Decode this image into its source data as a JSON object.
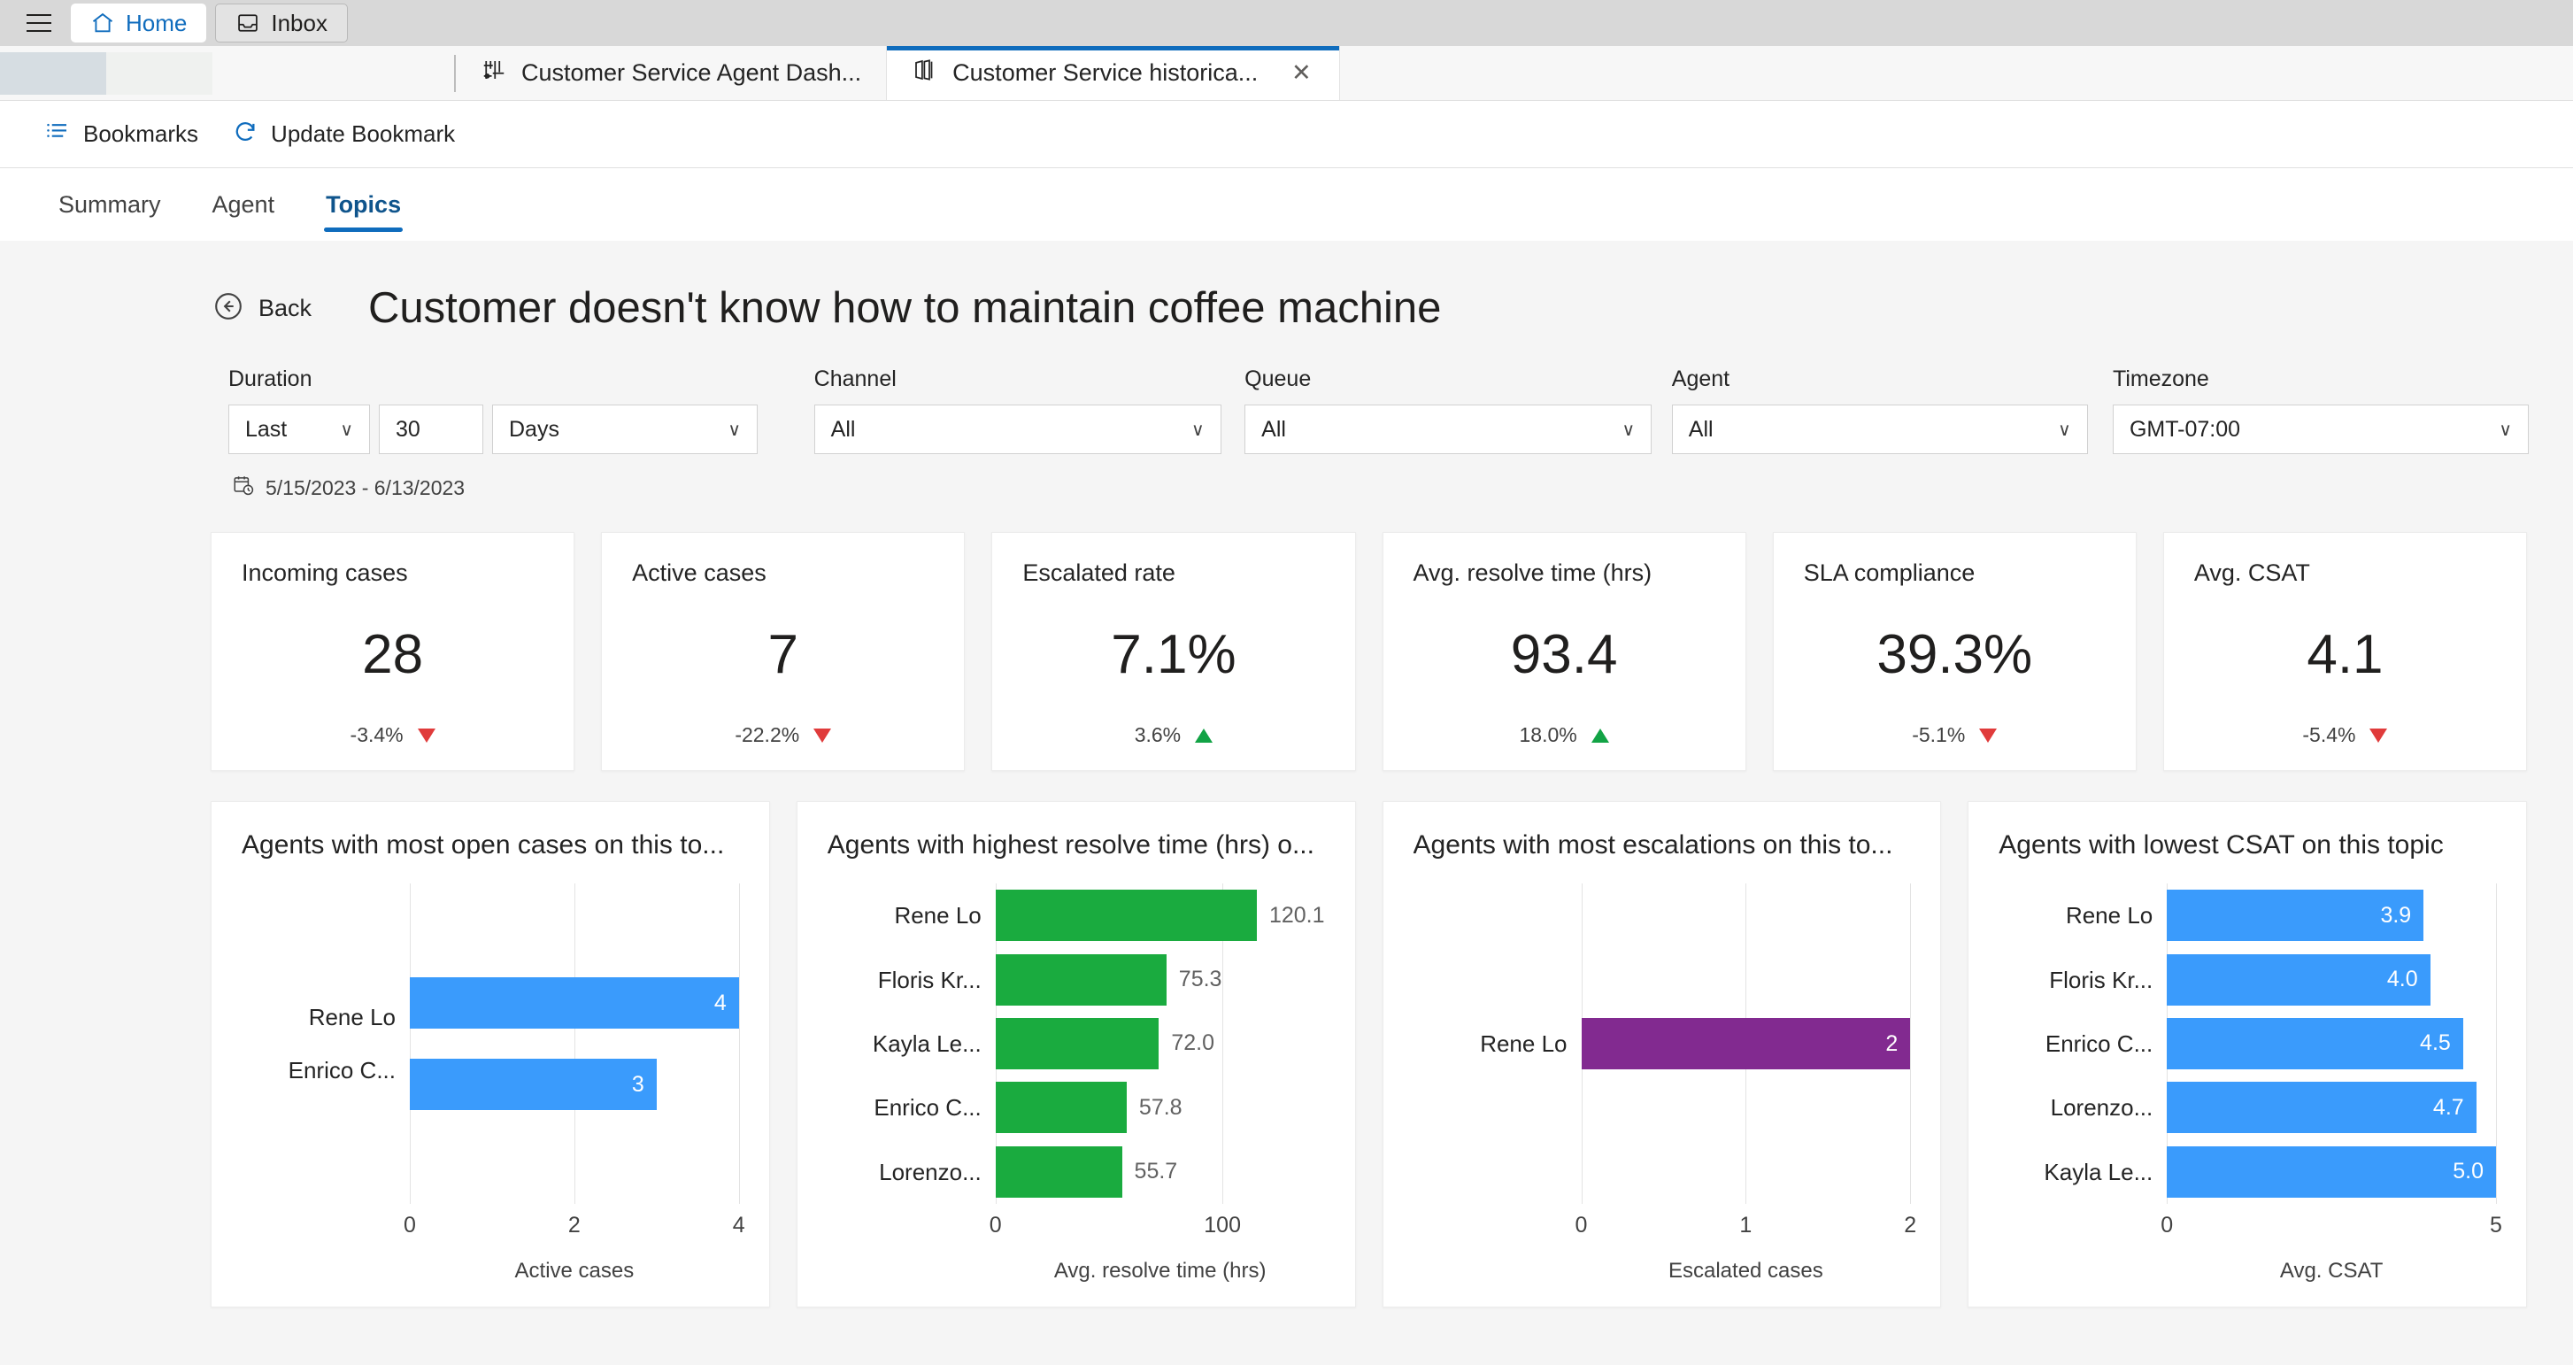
{
  "appbar": {
    "menu_icon": "hamburger-icon",
    "buttons": [
      {
        "label": "Home",
        "icon": "home-icon",
        "active": true
      },
      {
        "label": "Inbox",
        "icon": "inbox-icon",
        "active": false
      }
    ]
  },
  "tabstrip": {
    "tabs": [
      {
        "label": "Customer Service Agent Dash...",
        "icon": "dashboard-icon",
        "selected": false,
        "closable": false
      },
      {
        "label": "Customer Service historica...",
        "icon": "book-icon",
        "selected": true,
        "closable": true
      }
    ],
    "close_glyph": "✕"
  },
  "commandbar": {
    "commands": [
      {
        "label": "Bookmarks",
        "icon": "bookmarks-icon"
      },
      {
        "label": "Update Bookmark",
        "icon": "refresh-icon"
      }
    ]
  },
  "navtabs": {
    "items": [
      {
        "label": "Summary",
        "active": false
      },
      {
        "label": "Agent",
        "active": false
      },
      {
        "label": "Topics",
        "active": true
      }
    ]
  },
  "header": {
    "back_label": "Back",
    "back_icon": "arrow-left-circle-icon",
    "title": "Customer doesn't know how to maintain coffee machine"
  },
  "filters": {
    "duration": {
      "label": "Duration",
      "relative": "Last",
      "amount": "30",
      "unit": "Days"
    },
    "channel": {
      "label": "Channel",
      "value": "All"
    },
    "queue": {
      "label": "Queue",
      "value": "All"
    },
    "agent": {
      "label": "Agent",
      "value": "All"
    },
    "timezone": {
      "label": "Timezone",
      "value": "GMT-07:00"
    },
    "chevron": "∨",
    "date_range": "5/15/2023 - 6/13/2023",
    "date_icon": "calendar-clock-icon"
  },
  "kpis": [
    {
      "title": "Incoming cases",
      "value": "28",
      "delta": "-3.4%",
      "direction": "down"
    },
    {
      "title": "Active cases",
      "value": "7",
      "delta": "-22.2%",
      "direction": "down"
    },
    {
      "title": "Escalated rate",
      "value": "7.1%",
      "delta": "3.6%",
      "direction": "up"
    },
    {
      "title": "Avg. resolve time (hrs)",
      "value": "93.4",
      "delta": "18.0%",
      "direction": "up"
    },
    {
      "title": "SLA compliance",
      "value": "39.3%",
      "delta": "-5.1%",
      "direction": "down"
    },
    {
      "title": "Avg. CSAT",
      "value": "4.1",
      "delta": "-5.4%",
      "direction": "down"
    }
  ],
  "colors": {
    "blue": "#3a9bfc",
    "green": "#1aab3f",
    "purple": "#822a90",
    "accent": "#0f6cbd",
    "up": "#12a345",
    "down": "#e03b3b"
  },
  "chart_data": [
    {
      "type": "bar",
      "orientation": "horizontal",
      "title": "Agents with most open cases on this to...",
      "categories": [
        "Rene Lo",
        "Enrico C..."
      ],
      "values": [
        4,
        3
      ],
      "labels": [
        "4",
        "3"
      ],
      "label_position": "inside",
      "xlabel": "Active cases",
      "ylabel": "",
      "xlim": [
        0,
        4
      ],
      "ticks": [
        "0",
        "2",
        "4"
      ],
      "tick_values": [
        0,
        2,
        4
      ],
      "color": "#3a9bfc",
      "grid": true,
      "legend": "none"
    },
    {
      "type": "bar",
      "orientation": "horizontal",
      "title": "Agents with highest resolve time (hrs) o...",
      "categories": [
        "Rene Lo",
        "Floris Kr...",
        "Kayla Le...",
        "Enrico C...",
        "Lorenzo..."
      ],
      "values": [
        120.1,
        75.3,
        72.0,
        57.8,
        55.7
      ],
      "labels": [
        "120.1",
        "75.3",
        "72.0",
        "57.8",
        "55.7"
      ],
      "label_position": "outside",
      "xlabel": "Avg. resolve time (hrs)",
      "ylabel": "",
      "xlim": [
        0,
        145
      ],
      "ticks": [
        "0",
        "100"
      ],
      "tick_values": [
        0,
        100
      ],
      "color": "#1aab3f",
      "grid": true,
      "legend": "none"
    },
    {
      "type": "bar",
      "orientation": "horizontal",
      "title": "Agents with most escalations on this to...",
      "categories": [
        "Rene Lo"
      ],
      "values": [
        2
      ],
      "labels": [
        "2"
      ],
      "label_position": "inside",
      "xlabel": "Escalated cases",
      "ylabel": "",
      "xlim": [
        0,
        2
      ],
      "ticks": [
        "0",
        "1",
        "2"
      ],
      "tick_values": [
        0,
        1,
        2
      ],
      "color": "#822a90",
      "grid": true,
      "legend": "none"
    },
    {
      "type": "bar",
      "orientation": "horizontal",
      "title": "Agents with lowest CSAT on this topic",
      "categories": [
        "Rene Lo",
        "Floris Kr...",
        "Enrico C...",
        "Lorenzo...",
        "Kayla Le..."
      ],
      "values": [
        3.9,
        4.0,
        4.5,
        4.7,
        5.0
      ],
      "labels": [
        "3.9",
        "4.0",
        "4.5",
        "4.7",
        "5.0"
      ],
      "label_position": "inside",
      "xlabel": "Avg. CSAT",
      "ylabel": "",
      "xlim": [
        0,
        5
      ],
      "ticks": [
        "0",
        "5"
      ],
      "tick_values": [
        0,
        5
      ],
      "color": "#3a9bfc",
      "grid": true,
      "legend": "none"
    }
  ]
}
